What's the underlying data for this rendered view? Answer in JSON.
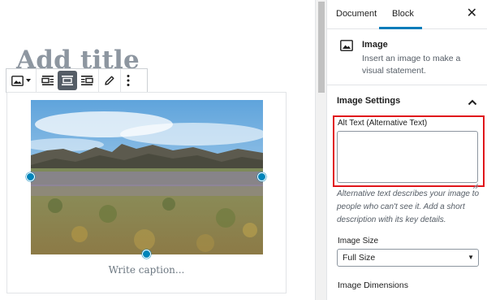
{
  "editor": {
    "title_placeholder": "Add title",
    "caption_placeholder": "Write caption...",
    "toolbar": {
      "buttons": [
        "image-icon",
        "chevron-down-icon",
        "align-left-icon",
        "align-center-icon",
        "align-right-icon",
        "pencil-icon",
        "more-vertical-icon"
      ],
      "active": "align-center-icon"
    }
  },
  "sidebar": {
    "tabs": [
      {
        "label": "Document",
        "active": false
      },
      {
        "label": "Block",
        "active": true
      }
    ],
    "close_label": "✕",
    "block": {
      "name": "Image",
      "description": "Insert an image to make a visual statement."
    },
    "settings_panel": {
      "title": "Image Settings",
      "alt_label": "Alt Text (Alternative Text)",
      "alt_value": "",
      "help": "Alternative text describes your image to people who can't see it. Add a short description with its key details.",
      "size_label": "Image Size",
      "size_value": "Full Size",
      "dimensions_label": "Image Dimensions"
    }
  },
  "colors": {
    "accent": "#007cba",
    "handle": "#0085ba",
    "highlight": "#e0161b",
    "toolbar_active": "#555d66"
  }
}
